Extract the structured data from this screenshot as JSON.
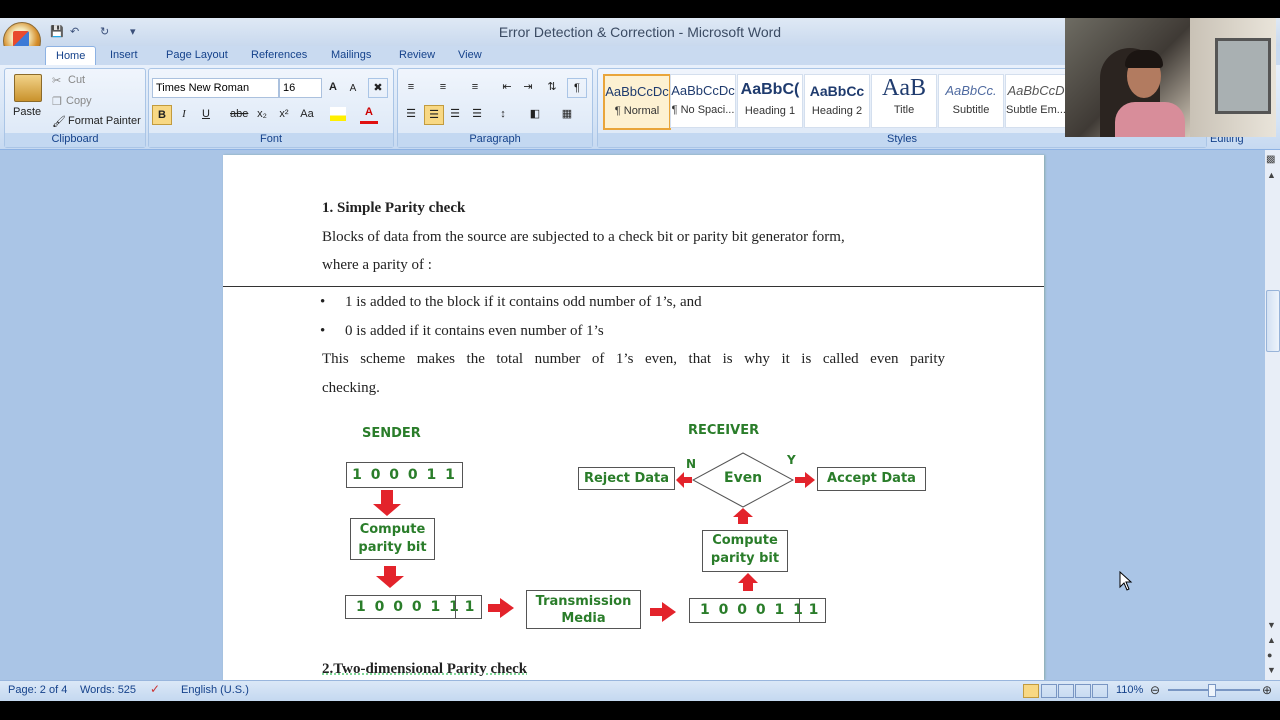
{
  "window": {
    "title": "Error Detection & Correction - Microsoft Word"
  },
  "tabs": [
    "Home",
    "Insert",
    "Page Layout",
    "References",
    "Mailings",
    "Review",
    "View"
  ],
  "clipboard": {
    "paste": "Paste",
    "cut": "Cut",
    "copy": "Copy",
    "format_painter": "Format Painter",
    "label": "Clipboard"
  },
  "font": {
    "family": "Times New Roman",
    "size": "16",
    "label": "Font",
    "grow": "A",
    "shrink": "A",
    "bold": "B",
    "italic": "I",
    "underline": "U",
    "strike": "abe",
    "subscript": "x₂",
    "superscript": "x²",
    "case": "Aa",
    "color_a": "A"
  },
  "paragraph": {
    "label": "Paragraph",
    "pilcrow": "¶"
  },
  "styles": {
    "label": "Styles",
    "items": [
      {
        "preview": "AaBbCcDc",
        "name": "¶ Normal"
      },
      {
        "preview": "AaBbCcDc",
        "name": "¶ No Spaci..."
      },
      {
        "preview": "AaBbC(",
        "name": "Heading 1"
      },
      {
        "preview": "AaBbCc",
        "name": "Heading 2"
      },
      {
        "preview": "AaB",
        "name": "Title"
      },
      {
        "preview": "AaBbCc.",
        "name": "Subtitle"
      },
      {
        "preview": "AaBbCcD",
        "name": "Subtle Em..."
      }
    ]
  },
  "editing": {
    "label": "Editing"
  },
  "doc": {
    "heading1": "1. Simple Parity check",
    "para1_line1": "Blocks of data from the source are subjected to a check bit or parity bit generator form,",
    "para1_line2": "where a parity of :",
    "bullets": [
      "1 is added to the block if it contains odd number of 1’s, and",
      "0 is added if it contains even number of 1’s"
    ],
    "para2_line1": "This scheme makes the total number of 1’s even, that is why it is called even parity",
    "para2_line2": "checking.",
    "heading2": "2.Two-dimensional   Parity check"
  },
  "diagram": {
    "sender": "SENDER",
    "receiver": "RECEIVER",
    "data_bits": "1 0 0 0 1 1",
    "data_bits2": "1 0  0 0 1 1",
    "parity": "1",
    "compute1": "Compute parity bit",
    "compute2": "Compute parity bit",
    "transmission": "Transmission Media",
    "even": "Even",
    "reject": "Reject Data",
    "accept": "Accept Data",
    "n": "N",
    "y": "Y",
    "arrow_color": "#e3232b",
    "text_color": "#2a7d2a"
  },
  "status": {
    "page": "Page: 2 of 4",
    "words": "Words: 525",
    "language": "English (U.S.)",
    "zoom": "110%"
  }
}
